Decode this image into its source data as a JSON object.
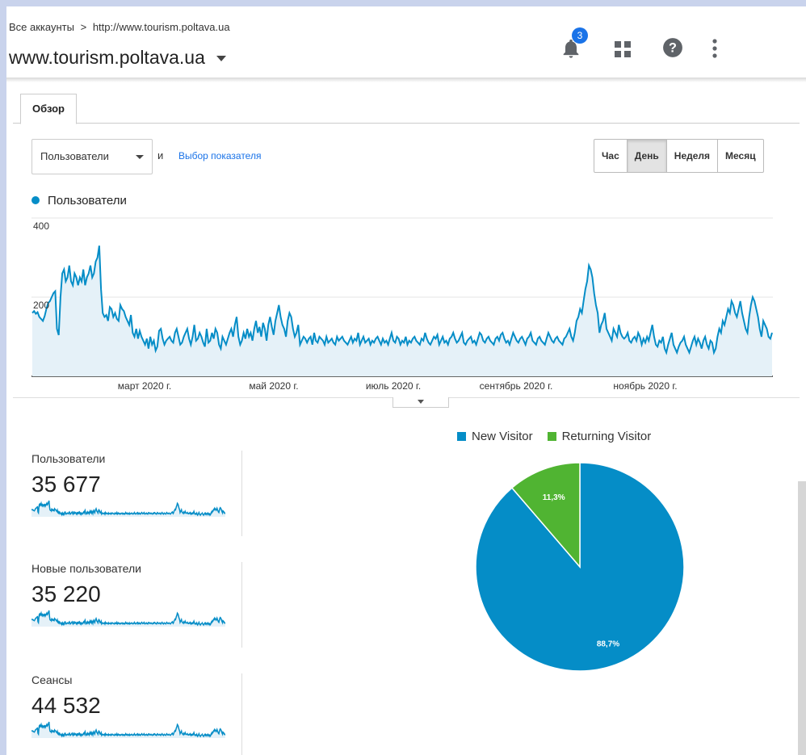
{
  "header": {
    "breadcrumb_root": "Все аккаунты",
    "breadcrumb_sep": ">",
    "breadcrumb_account": "http://www.tourism.poltava.ua",
    "property": "www.tourism.poltava.ua",
    "notifications_count": "3",
    "icons": [
      "bell-icon",
      "apps-icon",
      "help-icon",
      "more-vert-icon"
    ]
  },
  "tabs": [
    {
      "label": "Обзор",
      "active": true
    }
  ],
  "controls": {
    "metric_select": "Пользователи",
    "and_label": "и",
    "select_metric_link": "Выбор показателя",
    "granularity": [
      {
        "label": "Час",
        "active": false
      },
      {
        "label": "День",
        "active": true
      },
      {
        "label": "Неделя",
        "active": false
      },
      {
        "label": "Месяц",
        "active": false
      }
    ]
  },
  "chart_data": [
    {
      "type": "area",
      "legend": "Пользователи",
      "color": "#058dc7",
      "y_ticks": [
        "400",
        "200"
      ],
      "ylim": [
        0,
        400
      ],
      "x_tick_labels": [
        "март 2020 г.",
        "май 2020 г.",
        "июль 2020 г.",
        "сентябрь 2020 г.",
        "ноябрь 2020 г."
      ],
      "values": [
        160,
        165,
        158,
        162,
        150,
        145,
        140,
        152,
        170,
        185,
        190,
        200,
        210,
        215,
        120,
        104,
        200,
        260,
        270,
        240,
        250,
        280,
        240,
        230,
        260,
        250,
        230,
        250,
        240,
        270,
        230,
        250,
        260,
        280,
        250,
        260,
        290,
        300,
        330,
        220,
        160,
        150,
        155,
        140,
        175,
        170,
        150,
        160,
        145,
        140,
        180,
        170,
        165,
        150,
        140,
        130,
        155,
        110,
        100,
        120,
        95,
        115,
        100,
        90,
        80,
        95,
        70,
        100,
        80,
        90,
        65,
        75,
        115,
        120,
        95,
        80,
        90,
        95,
        100,
        90,
        85,
        110,
        120,
        100,
        80,
        85,
        100,
        110,
        120,
        95,
        80,
        100,
        130,
        90,
        95,
        110,
        100,
        85,
        75,
        120,
        85,
        90,
        110,
        95,
        120,
        110,
        80,
        70,
        100,
        90,
        80,
        95,
        110,
        120,
        100,
        130,
        150,
        100,
        80,
        90,
        110,
        95,
        120,
        100,
        110,
        90,
        120,
        140,
        110,
        125,
        100,
        135,
        120,
        90,
        130,
        150,
        125,
        105,
        140,
        160,
        180,
        150,
        130,
        120,
        100,
        140,
        160,
        150,
        120,
        100,
        110,
        130,
        80,
        90,
        100,
        95,
        85,
        95,
        100,
        80,
        110,
        90,
        85,
        100,
        95,
        90,
        80,
        100,
        85,
        90,
        95,
        85,
        80,
        100,
        90,
        95,
        100,
        90,
        85,
        80,
        90,
        100,
        85,
        95,
        90,
        110,
        80,
        90,
        100,
        85,
        90,
        95,
        80,
        90,
        85,
        95,
        100,
        90,
        80,
        95,
        85,
        90,
        80,
        95,
        110,
        90,
        85,
        100,
        95,
        80,
        90,
        85,
        100,
        80,
        90,
        85,
        95,
        100,
        90,
        85,
        80,
        95,
        90,
        110,
        95,
        85,
        80,
        90,
        100,
        95,
        105,
        80,
        90,
        100,
        85,
        90,
        80,
        95,
        100,
        110,
        95,
        85,
        90,
        100,
        110,
        85,
        80,
        90,
        95,
        100,
        85,
        90,
        80,
        95,
        110,
        105,
        90,
        85,
        95,
        100,
        90,
        85,
        80,
        95,
        100,
        90,
        105,
        110,
        95,
        85,
        90,
        80,
        95,
        110,
        100,
        90,
        85,
        95,
        100,
        90,
        80,
        95,
        100,
        110,
        90,
        85,
        80,
        95,
        100,
        90,
        85,
        80,
        95,
        110,
        100,
        90,
        85,
        95,
        100,
        90,
        85,
        80,
        95,
        100,
        110,
        120,
        100,
        90,
        110,
        140,
        150,
        170,
        160,
        190,
        220,
        240,
        280,
        270,
        250,
        210,
        180,
        160,
        110,
        130,
        140,
        160,
        120,
        110,
        100,
        90,
        120,
        110,
        100,
        130,
        110,
        100,
        95,
        100,
        110,
        90,
        85,
        95,
        100,
        90,
        110,
        100,
        80,
        95,
        85,
        100,
        90,
        110,
        130,
        100,
        80,
        75,
        90,
        85,
        100,
        70,
        60,
        80,
        95,
        110,
        80,
        70,
        60,
        75,
        85,
        90,
        100,
        80,
        70,
        60,
        75,
        90,
        100,
        80,
        95,
        85,
        70,
        90,
        100,
        80,
        70,
        90,
        85,
        60,
        70,
        100,
        120,
        110,
        140,
        130,
        150,
        170,
        160,
        190,
        180,
        160,
        150,
        170,
        190,
        160,
        140,
        120,
        110,
        150,
        180,
        200,
        190,
        170,
        150,
        120,
        100,
        140,
        130,
        120,
        100,
        95,
        110
      ]
    },
    {
      "type": "pie",
      "slices": [
        {
          "name": "New Visitor",
          "value": 88.7,
          "label": "88,7%",
          "color": "#058dc7"
        },
        {
          "name": "Returning Visitor",
          "value": 11.3,
          "label": "11,3%",
          "color": "#50b432"
        }
      ]
    }
  ],
  "stats": [
    {
      "label": "Пользователи",
      "value": "35 677"
    },
    {
      "label": "Новые пользователи",
      "value": "35 220"
    },
    {
      "label": "Сеансы",
      "value": "44 532"
    }
  ]
}
